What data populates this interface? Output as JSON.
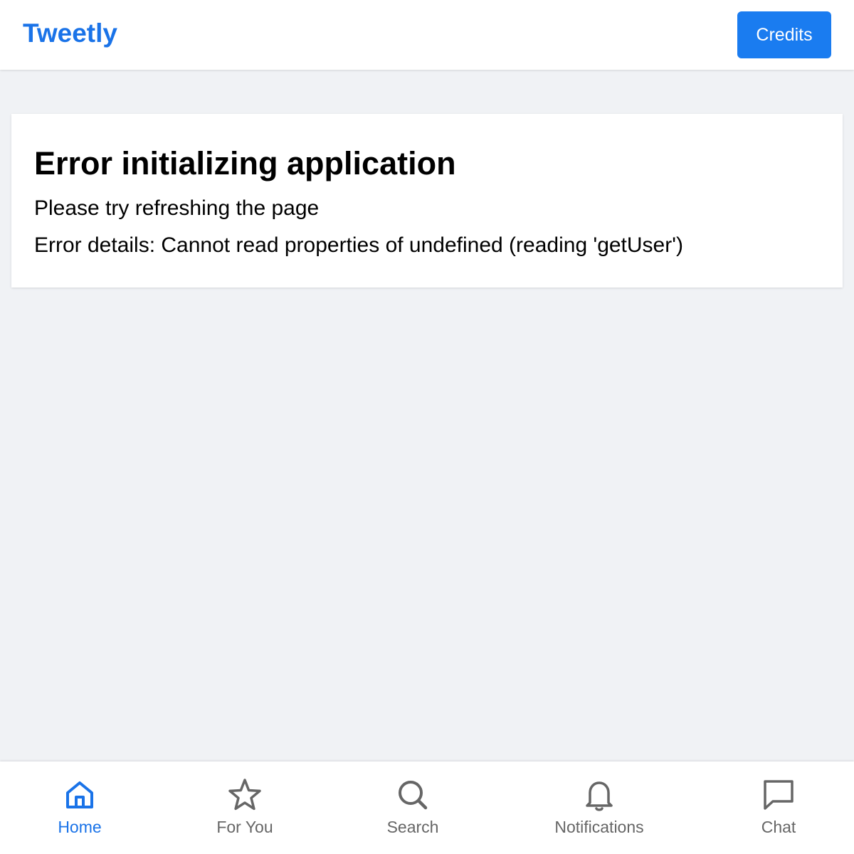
{
  "app": {
    "logo": "Tweetly",
    "credits_label": "Credits"
  },
  "error": {
    "title": "Error initializing application",
    "message": "Please try refreshing the page",
    "details": "Error details: Cannot read properties of undefined (reading 'getUser')"
  },
  "bottom_nav": {
    "items": [
      {
        "label": "Home",
        "icon": "home-icon",
        "active": true
      },
      {
        "label": "For You",
        "icon": "star-icon",
        "active": false
      },
      {
        "label": "Search",
        "icon": "search-icon",
        "active": false
      },
      {
        "label": "Notifications",
        "icon": "bell-icon",
        "active": false
      },
      {
        "label": "Chat",
        "icon": "chat-icon",
        "active": false
      }
    ]
  },
  "colors": {
    "accent": "#1a73e8",
    "button": "#1a7cf0",
    "page_background": "#f0f2f5",
    "inactive_nav": "#666666"
  }
}
